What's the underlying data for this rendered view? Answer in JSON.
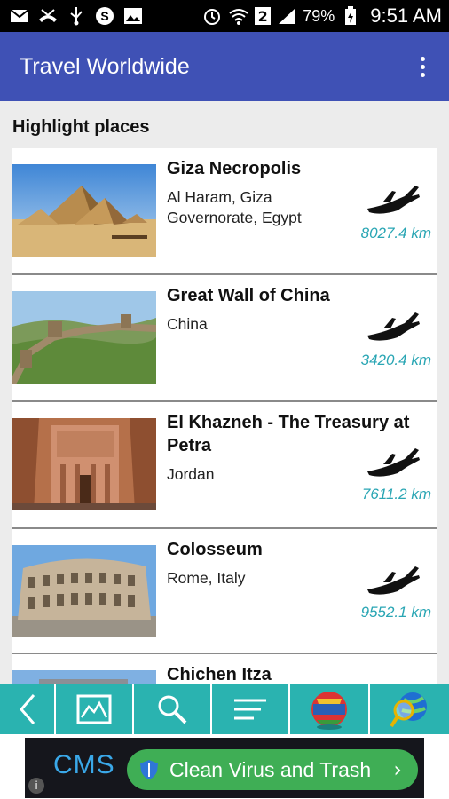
{
  "status_bar": {
    "battery": "79%",
    "sim_badge": "2",
    "time": "9:51 AM"
  },
  "app_bar": {
    "title": "Travel Worldwide"
  },
  "section": {
    "title": "Highlight places"
  },
  "places": [
    {
      "name": "Giza Necropolis",
      "location": "Al Haram, Giza Governorate, Egypt",
      "distance": "8027.4 km"
    },
    {
      "name": "Great Wall of China",
      "location": "China",
      "distance": "3420.4 km"
    },
    {
      "name": "El Khazneh - The Treasury at Petra",
      "location": "Jordan",
      "distance": "7611.2 km"
    },
    {
      "name": "Colosseum",
      "location": "Rome, Italy",
      "distance": "9552.1 km"
    },
    {
      "name": "Chichen Itza",
      "location": "",
      "distance": ""
    }
  ],
  "toolbar": {
    "buttons": [
      "back-icon",
      "map-icon",
      "search-icon",
      "menu-icon",
      "world-flags-icon",
      "globe-search-icon"
    ]
  },
  "ad": {
    "brand": "CMS",
    "button_label": "Clean Virus and Trash",
    "info": "i"
  },
  "colors": {
    "app_bar": "#3f51b5",
    "toolbar": "#2ab3b0",
    "distance": "#2aa6b4",
    "ad_button": "#3fae55"
  }
}
